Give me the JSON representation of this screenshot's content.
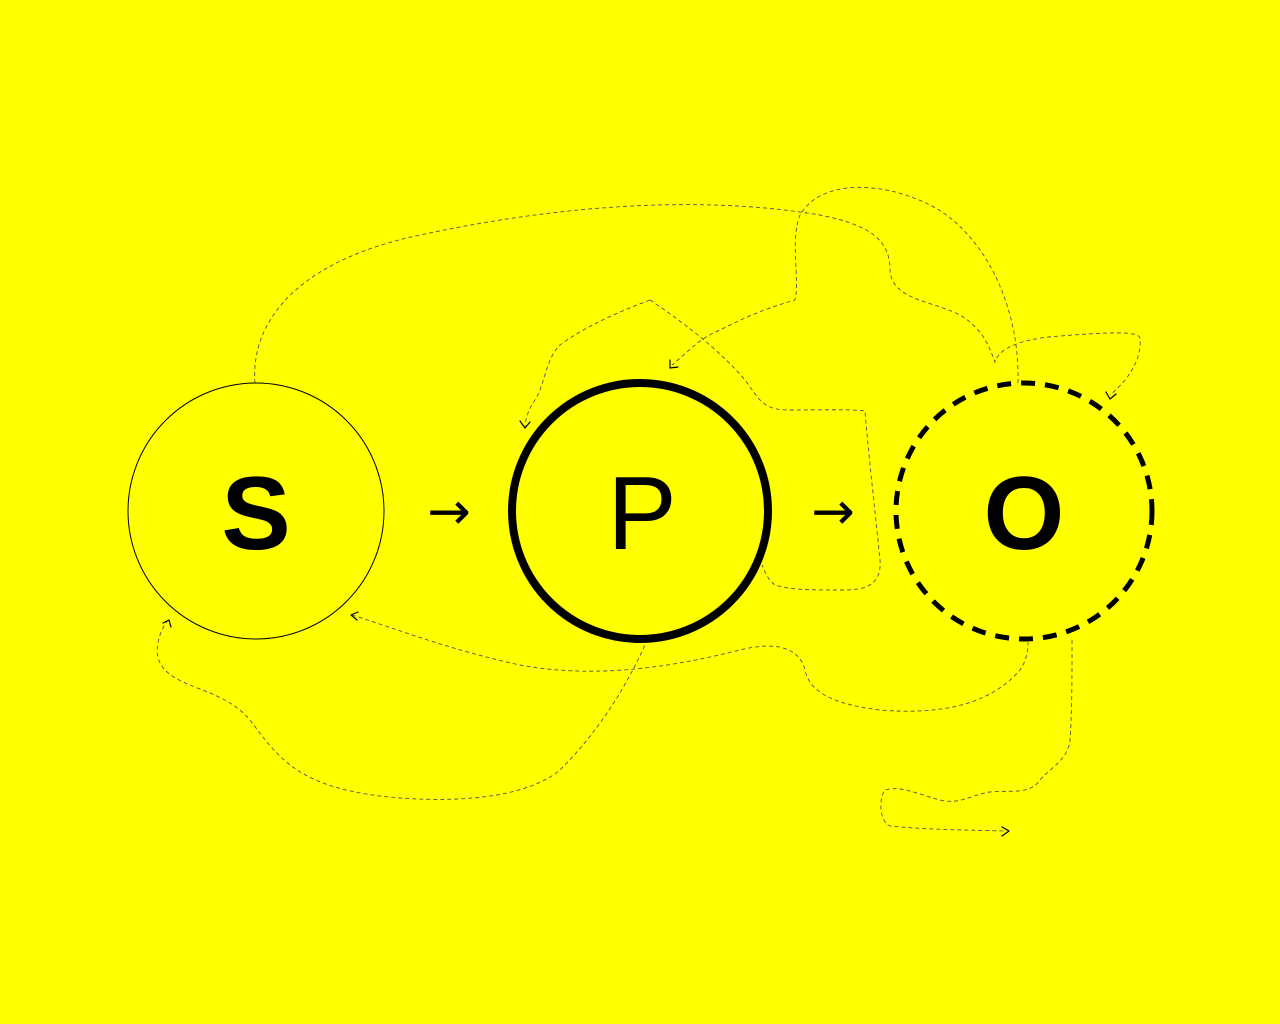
{
  "colors": {
    "background": "#ffff00",
    "ink": "#000000"
  },
  "nodes": [
    {
      "id": "s",
      "label": "S",
      "border_style": "thin-solid"
    },
    {
      "id": "p",
      "label": "P",
      "border_style": "thick-solid"
    },
    {
      "id": "o",
      "label": "O",
      "border_style": "thick-dashed"
    }
  ],
  "connectors": [
    {
      "from": "s",
      "to": "p",
      "glyph": "→"
    },
    {
      "from": "p",
      "to": "o",
      "glyph": "→"
    }
  ]
}
